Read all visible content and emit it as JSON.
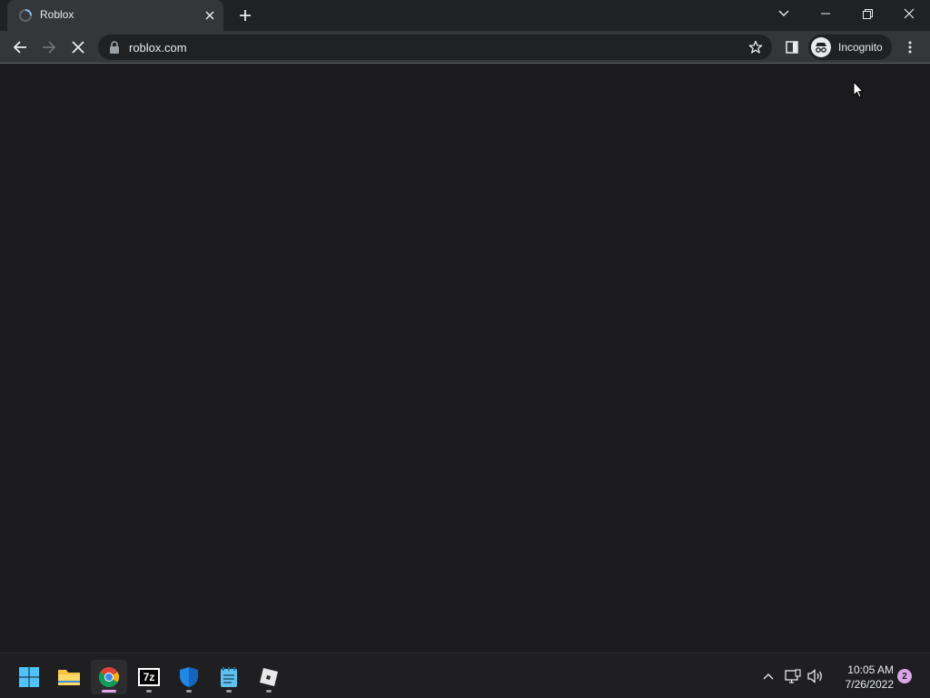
{
  "browser": {
    "tab": {
      "title": "Roblox"
    },
    "omnibox": {
      "url": "roblox.com"
    },
    "profile": {
      "label": "Incognito"
    },
    "theme": {
      "tab_bg": "#35363a",
      "frame_bg": "#202124",
      "page_bg": "#1b1b1d"
    }
  },
  "taskbar": {
    "apps": [
      {
        "name": "start",
        "icon": "windows-logo-icon"
      },
      {
        "name": "file-explorer",
        "icon": "folder-icon"
      },
      {
        "name": "chrome",
        "icon": "chrome-icon",
        "active": true
      },
      {
        "name": "7-zip",
        "icon": "7zip-icon",
        "label": "7z"
      },
      {
        "name": "windows-security",
        "icon": "shield-icon"
      },
      {
        "name": "notepad",
        "icon": "notepad-icon"
      },
      {
        "name": "roblox",
        "icon": "roblox-icon"
      }
    ],
    "clock": {
      "time": "10:05 AM",
      "date": "7/26/2022"
    },
    "notifications": {
      "count": "2"
    }
  }
}
